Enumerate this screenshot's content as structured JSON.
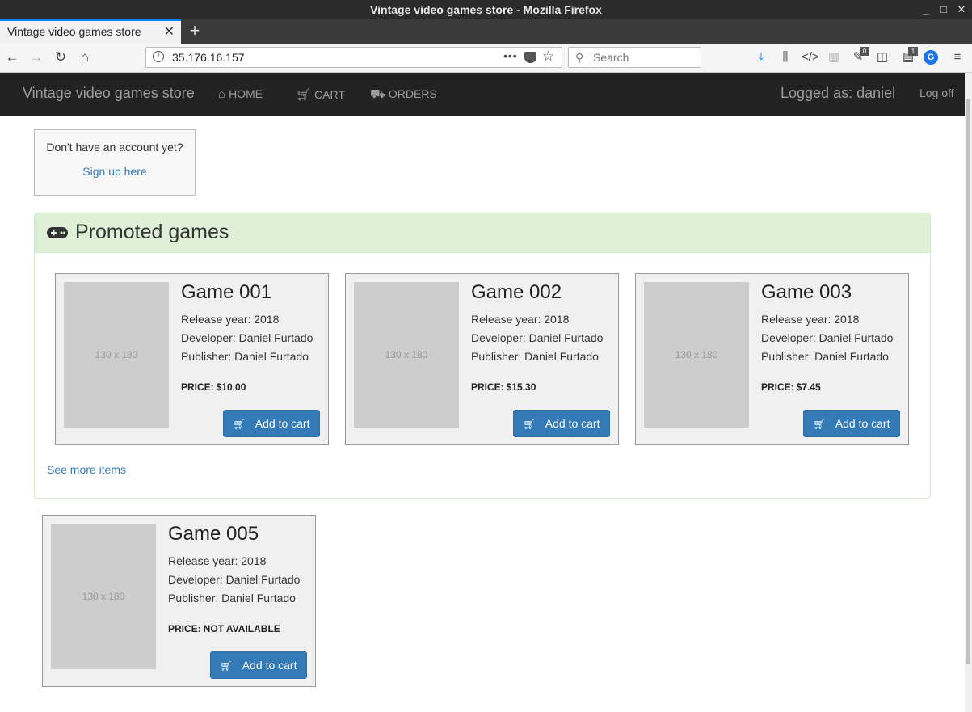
{
  "window": {
    "title": "Vintage video games store - Mozilla Firefox",
    "controls": [
      "_",
      "□",
      "✕"
    ]
  },
  "browser": {
    "tab_title": "Vintage video games store",
    "url": "35.176.16.157",
    "search_placeholder": "Search",
    "page_actions": "•••",
    "badges": {
      "extension_a": "0",
      "extension_b": "1"
    }
  },
  "site": {
    "brand": "Vintage video games store",
    "nav": [
      {
        "label": "HOME",
        "icon": "home-icon"
      },
      {
        "label": "CART",
        "icon": "shopping-cart-icon"
      },
      {
        "label": "ORDERS",
        "icon": "truck-icon"
      }
    ],
    "logged_as": "Logged as: daniel",
    "log_off": "Log off"
  },
  "signup": {
    "question": "Don't have an account yet?",
    "link": "Sign up here"
  },
  "promoted": {
    "title": "Promoted games",
    "see_more": "See more items",
    "colors": {
      "heading_bg": "#dff0d8",
      "link": "#337ab7",
      "button": "#337ab7"
    }
  },
  "games": [
    {
      "name": "Game 001",
      "thumb": "130 x 180",
      "release": "Release year: 2018",
      "developer": "Developer: Daniel Furtado",
      "publisher": "Publisher: Daniel Furtado",
      "price_label": "PRICE:",
      "price": "$10.00",
      "button": "Add to cart"
    },
    {
      "name": "Game 002",
      "thumb": "130 x 180",
      "release": "Release year: 2018",
      "developer": "Developer: Daniel Furtado",
      "publisher": "Publisher: Daniel Furtado",
      "price_label": "PRICE:",
      "price": "$15.30",
      "button": "Add to cart"
    },
    {
      "name": "Game 003",
      "thumb": "130 x 180",
      "release": "Release year: 2018",
      "developer": "Developer: Daniel Furtado",
      "publisher": "Publisher: Daniel Furtado",
      "price_label": "PRICE:",
      "price": "$7.45",
      "button": "Add to cart"
    },
    {
      "name": "Game 005",
      "thumb": "130 x 180",
      "release": "Release year: 2018",
      "developer": "Developer: Daniel Furtado",
      "publisher": "Publisher: Daniel Furtado",
      "price_label": "PRICE:",
      "price": "NOT AVAILABLE",
      "button": "Add to cart"
    }
  ]
}
